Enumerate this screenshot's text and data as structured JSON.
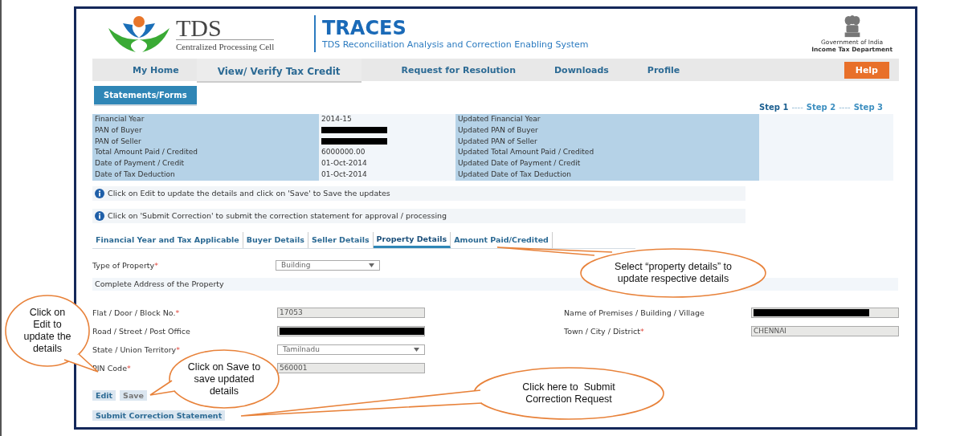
{
  "header": {
    "logo_title": "TDS",
    "logo_subtitle": "Centralized Processing Cell",
    "app_title": "TRACES",
    "app_subtitle": "TDS Reconciliation Analysis and Correction Enabling System",
    "emblem_caption": "Government of India",
    "department": "Income Tax Department"
  },
  "nav": [
    {
      "label": "My Home",
      "kind": "link",
      "selected": false
    },
    {
      "label": "View/ Verify Tax Credit",
      "kind": "link",
      "selected": true
    },
    {
      "label": "Request for Resolution",
      "kind": "link",
      "selected": false
    },
    {
      "label": "Downloads",
      "kind": "link",
      "selected": false
    },
    {
      "label": "Profile",
      "kind": "link",
      "selected": false
    },
    {
      "label": "Help",
      "kind": "help",
      "selected": false
    }
  ],
  "section_tab": "Statements/Forms",
  "steps": [
    {
      "label": "Step 1",
      "selected": true
    },
    {
      "label": "Step 2",
      "selected": false
    },
    {
      "label": "Step 3",
      "selected": false
    }
  ],
  "step_separator": "----",
  "summary": [
    {
      "label": "Financial Year",
      "value": "2014-15",
      "updated_label": "Updated Financial Year"
    },
    {
      "label": "PAN of Buyer",
      "updated_label": "Updated PAN of Buyer"
    },
    {
      "label": "PAN of Seller",
      "updated_label": "Updated PAN of Seller"
    },
    {
      "label": "Total Amount Paid / Credited",
      "value": "6000000.00",
      "updated_label": "Updated Total Amount Paid / Credited"
    },
    {
      "label": "Date of Payment / Credit",
      "value": "01-Oct-2014",
      "updated_label": "Updated Date of Payment / Credit"
    },
    {
      "label": "Date of Tax Deduction",
      "value": "01-Oct-2014",
      "updated_label": "Updated Date of Tax Deduction"
    }
  ],
  "info": [
    "Click on Edit to update the details and click on 'Save' to Save the updates",
    "Click on 'Submit Correction' to submit the correction statement for approval / processing"
  ],
  "tabs": [
    {
      "label": "Financial Year and Tax Applicable",
      "selected": false
    },
    {
      "label": "Buyer Details",
      "selected": false
    },
    {
      "label": "Seller Details",
      "selected": false
    },
    {
      "label": "Property Details",
      "selected": true
    },
    {
      "label": "Amount Paid/Credited",
      "selected": false
    }
  ],
  "required_mark": "*",
  "property_type": {
    "label": "Type of Property",
    "required": true,
    "value": "Building"
  },
  "address_heading": "Complete Address of the Property",
  "address_rows": [
    {
      "left": {
        "label": "Flat / Door / Block No.",
        "required": true,
        "kind": "text",
        "value": "17053"
      },
      "right": {
        "label": "Name of Premises / Building / Village",
        "required": false,
        "kind": "redacted"
      }
    },
    {
      "left": {
        "label": "Road / Street / Post Office",
        "required": false,
        "kind": "redacted"
      },
      "right": {
        "label": "Town / City / District",
        "required": true,
        "kind": "text",
        "value": "CHENNAI"
      }
    },
    {
      "left": {
        "label": "State / Union Territory",
        "required": true,
        "kind": "select",
        "value": "Tamilnadu"
      }
    },
    {
      "left": {
        "label": "PIN Code",
        "required": true,
        "kind": "text",
        "value": "560001"
      }
    }
  ],
  "buttons": [
    "Edit",
    "Save"
  ],
  "submit_button": "Submit Correction Statement",
  "callouts": [
    "Click on Edit to update the details",
    "Click on Save to save updated details",
    "Select “property details” to update respective details",
    "Click here to  Submit Correction Request"
  ]
}
